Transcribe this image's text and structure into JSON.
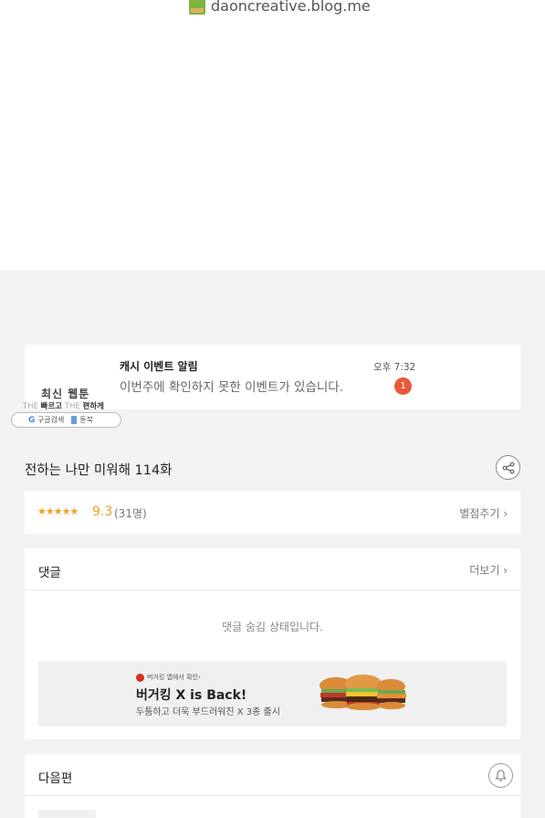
{
  "blog_credit": {
    "text": "daoncreative.blog.me",
    "logo_icon": "blog-logo-icon"
  },
  "notification": {
    "title": "캐시 이벤트 알림",
    "message": "이번주에 확인하지 못한 이벤트가 있습니다.",
    "time": "오후 7:32",
    "badge_count": "1"
  },
  "promo": {
    "title": "최신 웹툰",
    "tag_dim1": "THE",
    "tag_strong1": "빠르고",
    "tag_dim2": "THE",
    "tag_strong2": "편하게",
    "search_label": "구글검색",
    "app_label": "툰북"
  },
  "episode": {
    "title": "전하는 나만 미워해 114화",
    "share_icon": "share-icon"
  },
  "rating": {
    "stars": "★★★★★",
    "score": "9.3",
    "count": "(31명)",
    "rate_label": "별점주기 ›"
  },
  "comments": {
    "heading": "댓글",
    "more_label": "더보기 ›",
    "hidden_message": "댓글 숨김 상태입니다."
  },
  "ad": {
    "brand_line": "버거킹 앱에서 확인›",
    "headline": "버거킹 X is Back!",
    "subline": "두툼하고 더욱 부드러워진 X 3종 출시"
  },
  "next_episode": {
    "heading": "다음편",
    "bell_icon": "bell-icon"
  },
  "colors": {
    "accent_star": "#f0a020",
    "badge": "#e8593a",
    "page_bg": "#f2f2f2"
  }
}
